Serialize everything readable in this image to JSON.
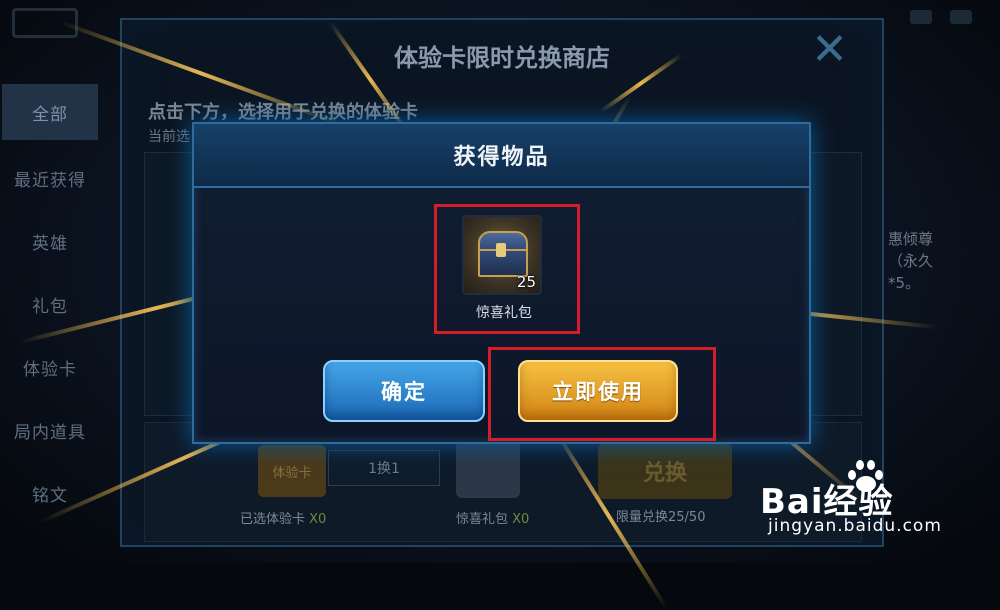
{
  "shop": {
    "title": "体验卡限时兑换商店",
    "hint": "点击下方，选择用于兑换的体验卡",
    "sub": "当前选",
    "desc": "惠倾尊（永久*5。",
    "selected_card_label": "已选体验卡",
    "selected_card_count": "X0",
    "ratio_label": "1换1",
    "card_icon_text": "体验卡",
    "reward_label": "惊喜礼包",
    "reward_count": "X0",
    "exchange_button": "兑换",
    "limit_text": "限量兑换25/50"
  },
  "sidebar": {
    "items": [
      {
        "label": "全部"
      },
      {
        "label": "最近获得"
      },
      {
        "label": "英雄"
      },
      {
        "label": "礼包"
      },
      {
        "label": "体验卡"
      },
      {
        "label": "局内道具"
      },
      {
        "label": "铭文"
      }
    ]
  },
  "modal": {
    "title": "获得物品",
    "item": {
      "name": "惊喜礼包",
      "count": "25",
      "icon": "treasure-chest-icon"
    },
    "confirm_label": "确定",
    "use_now_label": "立即使用",
    "highlight_color": "#d61c2a",
    "confirm_color": "#2b82d0",
    "use_color": "#e8a226"
  },
  "watermark": {
    "brand": "Bai经验",
    "url": "jingyan.baidu.com"
  }
}
